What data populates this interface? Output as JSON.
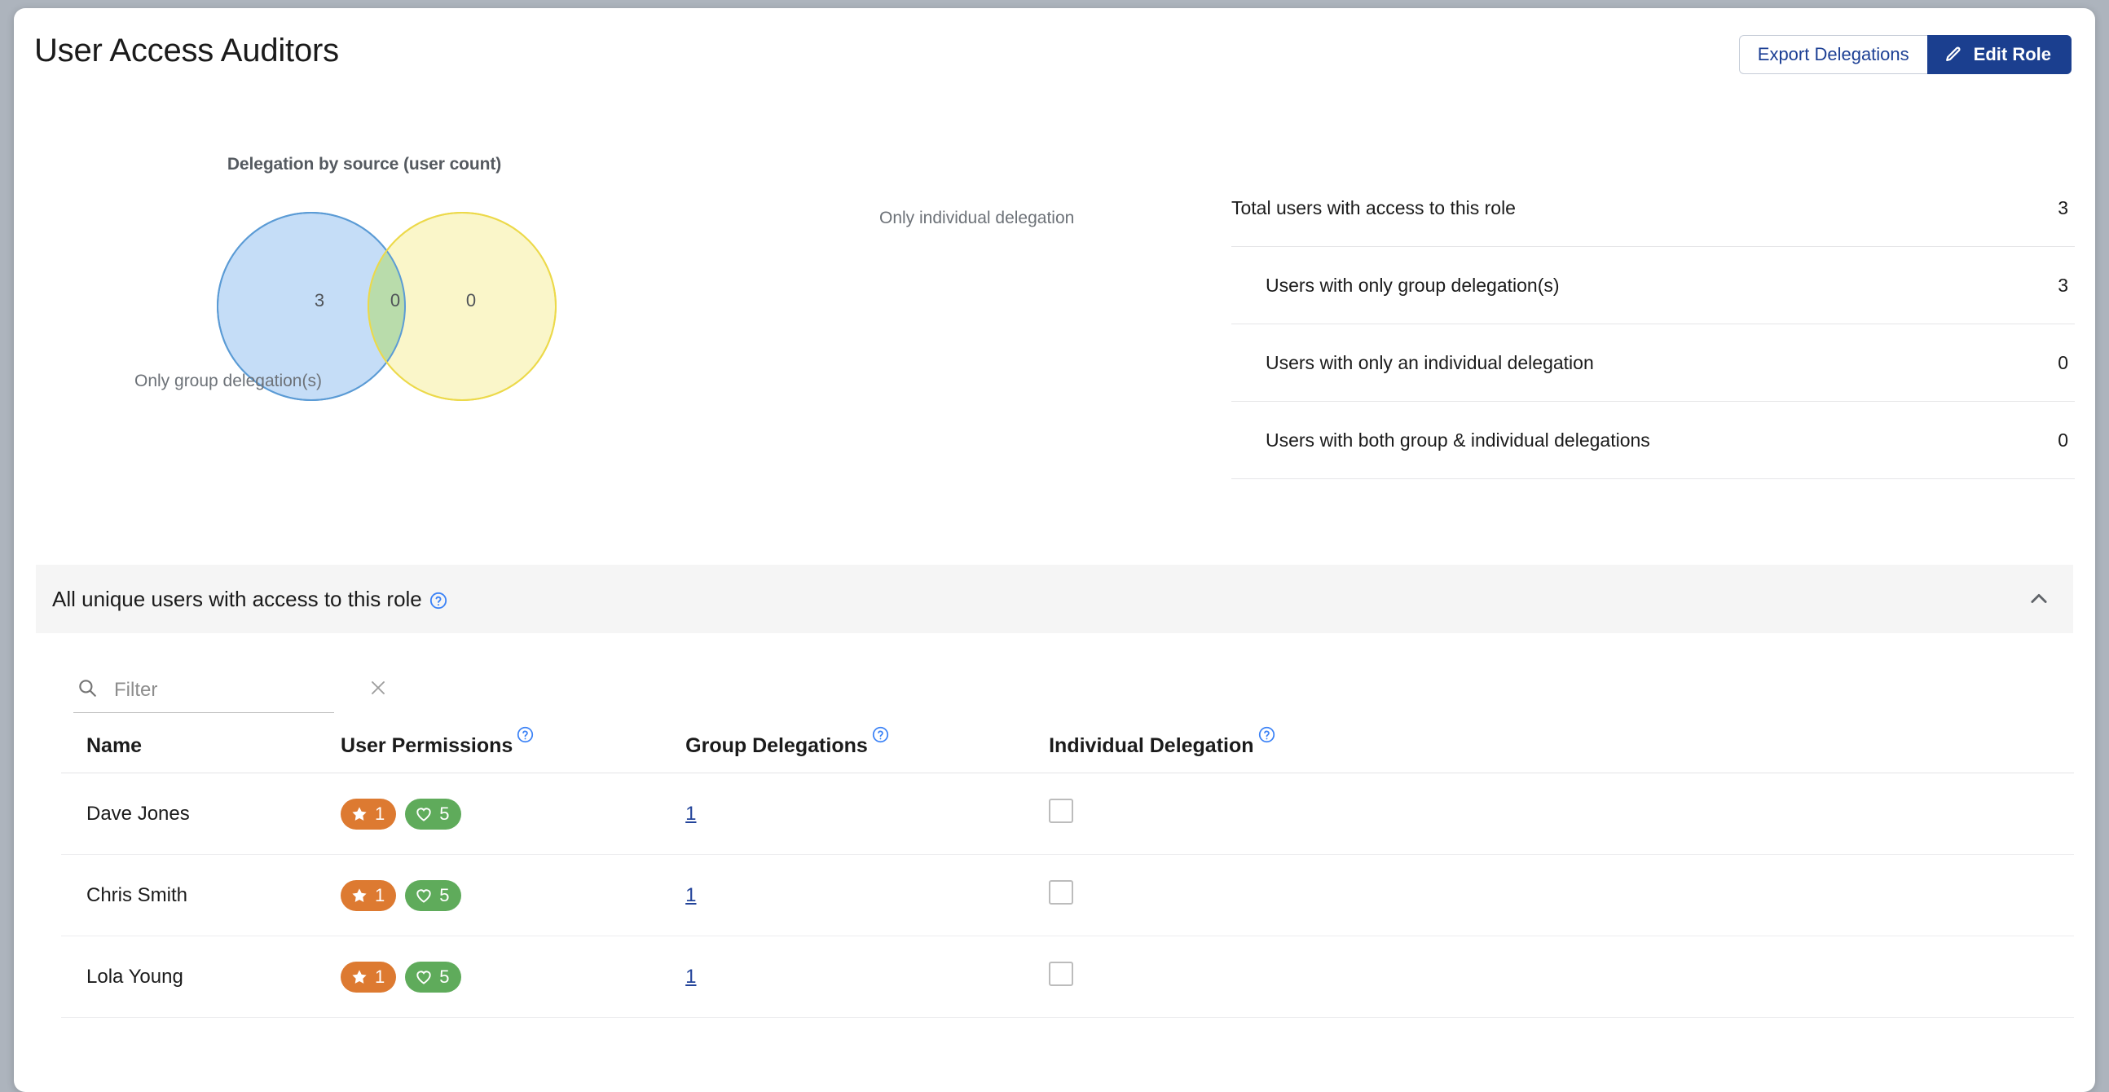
{
  "header": {
    "title": "User Access Auditors",
    "export_label": "Export Delegations",
    "edit_label": "Edit Role",
    "edit_icon": "pencil-icon"
  },
  "chart_data": {
    "type": "venn",
    "title": "Delegation by source (user count)",
    "left_label": "Only group delegation(s)",
    "right_label": "Only individual delegation",
    "left_only": "3",
    "intersection": "0",
    "right_only": "0",
    "left_fill": "#c5ddf7",
    "left_stroke": "#5b9bd5",
    "right_fill": "#faf5c6",
    "right_stroke": "#ecd94a",
    "intersection_fill": "#bedfb3"
  },
  "stats": {
    "rows": [
      {
        "label": "Total users with access to this role",
        "value": "3",
        "indent": false
      },
      {
        "label": "Users with only group delegation(s)",
        "value": "3",
        "indent": true
      },
      {
        "label": "Users with only an individual delegation",
        "value": "0",
        "indent": true
      },
      {
        "label": "Users with both group & individual delegations",
        "value": "0",
        "indent": true
      }
    ]
  },
  "panel": {
    "title": "All unique users with access to this role",
    "help_icon": "help-circle-icon",
    "collapse_icon": "chevron-up-icon"
  },
  "filter": {
    "placeholder": "Filter",
    "value": "",
    "search_icon": "search-icon",
    "clear_icon": "close-icon"
  },
  "table": {
    "columns": [
      {
        "label": "Name",
        "help": false
      },
      {
        "label": "User Permissions",
        "help": true
      },
      {
        "label": "Group Delegations",
        "help": true
      },
      {
        "label": "Individual Delegation",
        "help": true
      }
    ],
    "rows": [
      {
        "name": "Dave Jones",
        "star_count": "1",
        "heart_count": "5",
        "group_delegations": "1",
        "individual_delegation_checked": false
      },
      {
        "name": "Chris Smith",
        "star_count": "1",
        "heart_count": "5",
        "group_delegations": "1",
        "individual_delegation_checked": false
      },
      {
        "name": "Lola Young",
        "star_count": "1",
        "heart_count": "5",
        "group_delegations": "1",
        "individual_delegation_checked": false
      }
    ]
  },
  "colors": {
    "primary": "#1b3f8f",
    "link": "#23449a",
    "star_badge": "#dd7a31",
    "heart_badge": "#5fab5b",
    "page_bg": "#adb4bd"
  }
}
